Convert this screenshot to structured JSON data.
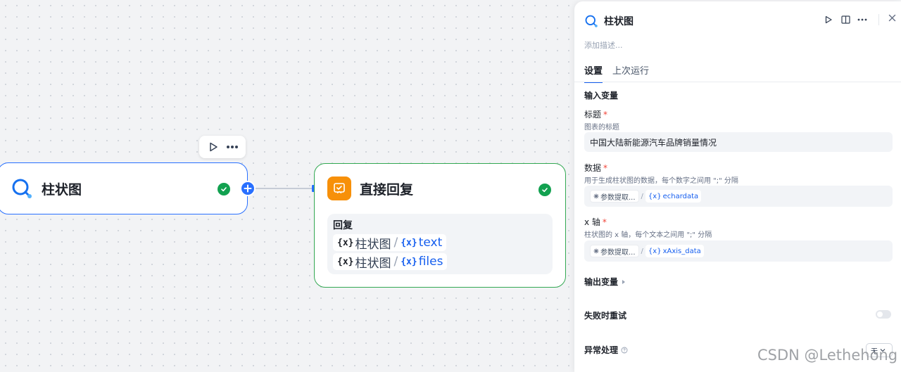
{
  "canvas": {
    "chart_node": {
      "title": "柱状图"
    },
    "reply_node": {
      "title": "直接回复",
      "section_label": "回复",
      "variables": [
        {
          "prefix": "{x}",
          "node": "柱状图",
          "separator": "/",
          "var_prefix": "{x}",
          "name": "text"
        },
        {
          "prefix": "{x}",
          "node": "柱状图",
          "separator": "/",
          "var_prefix": "{x}",
          "name": "files"
        }
      ]
    }
  },
  "panel": {
    "title": "柱状图",
    "description_placeholder": "添加描述...",
    "tabs": [
      {
        "label": "设置",
        "active": true
      },
      {
        "label": "上次运行",
        "active": false
      }
    ],
    "input_section": "输入变量",
    "fields": [
      {
        "label": "标题",
        "required": "*",
        "hint": "图表的标题",
        "value": "中国大陆新能源汽车品牌销量情况"
      },
      {
        "label": "数据",
        "required": "*",
        "hint": "用于生成柱状图的数据，每个数字之间用 \";\" 分隔",
        "chip": "参数提取...",
        "sep": "/",
        "var_prefix": "{x}",
        "var": "echardata"
      },
      {
        "label": "x 轴",
        "required": "*",
        "hint": "柱状图的 x 轴，每个文本之间用 \";\" 分隔",
        "chip": "参数提取...",
        "sep": "/",
        "var_prefix": "{x}",
        "var": "xAxis_data"
      }
    ],
    "output_section": "输出变量",
    "retry_label": "失败时重试",
    "retry_enabled": false,
    "error_label": "异常处理",
    "error_value": "无"
  },
  "watermark": "CSDN @Lethehong",
  "colors": {
    "accent": "#2970ff",
    "success": "#12a150",
    "reply_border": "#32a852",
    "reply_icon": "#f79009"
  }
}
